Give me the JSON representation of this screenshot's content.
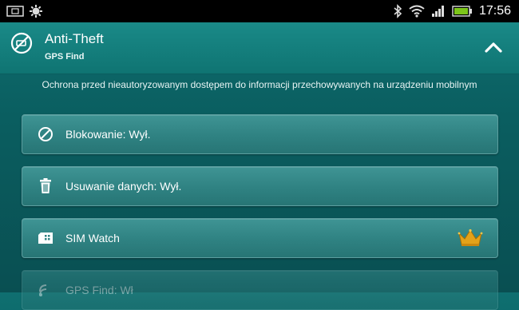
{
  "status_bar": {
    "time": "17:56",
    "left_icons": [
      "screen-mirror-icon",
      "settings-icon"
    ],
    "right_icons": [
      "bluetooth-icon",
      "wifi-icon",
      "signal-icon",
      "battery-icon"
    ]
  },
  "header": {
    "title": "Anti-Theft",
    "subtitle": "GPS Find",
    "icon": "anti-theft-icon",
    "collapse_icon": "chevron-up-icon"
  },
  "description": "Ochrona przed nieautoryzowanym dostępem do informacji przechowywanych na urządzeniu mobilnym",
  "items": [
    {
      "label": "Blokowanie: Wył.",
      "icon": "block-icon"
    },
    {
      "label": "Usuwanie danych: Wył.",
      "icon": "trash-icon"
    },
    {
      "label": "SIM Watch",
      "icon": "sim-card-icon",
      "badge": "crown-icon"
    },
    {
      "label": "GPS Find: Wł",
      "icon": "gps-icon"
    }
  ],
  "colors": {
    "background": "#0a5e60",
    "header": "#137d7b",
    "row": "#2f8282",
    "crown": "#e3a21a",
    "battery": "#7cc51a"
  }
}
